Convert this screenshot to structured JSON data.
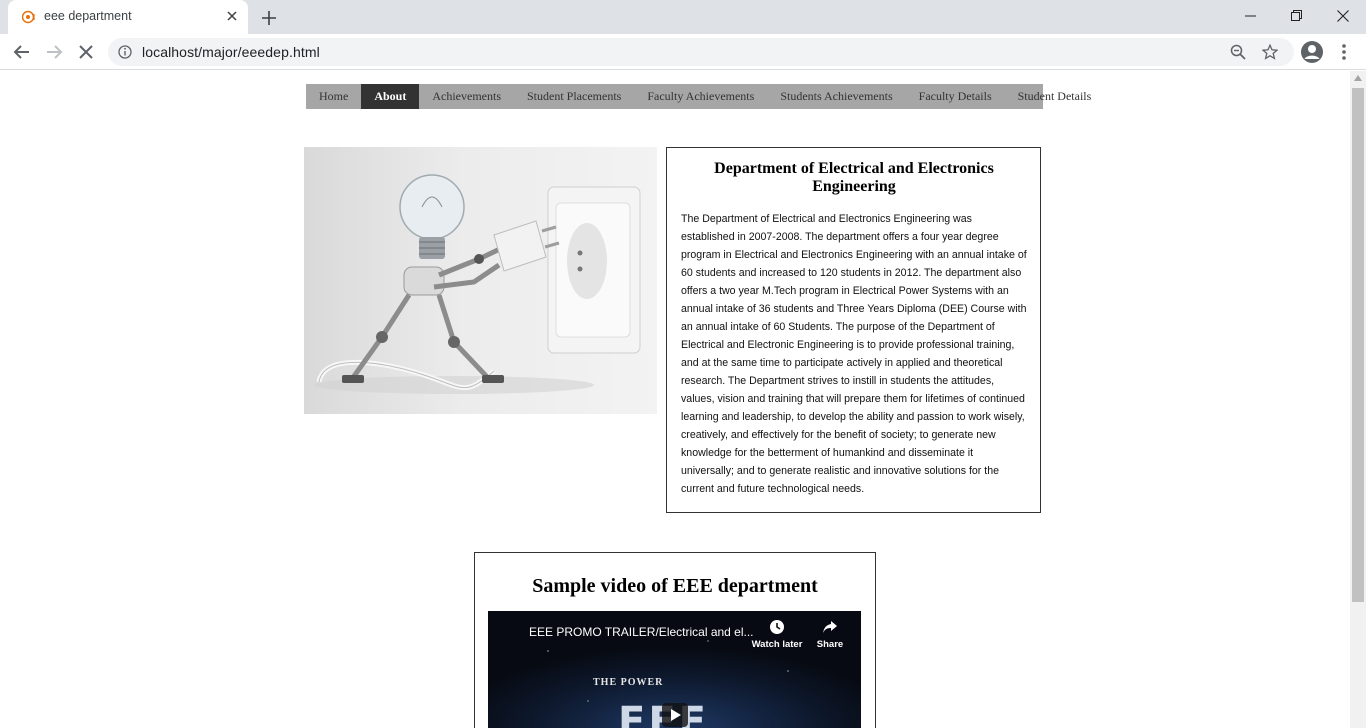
{
  "browser": {
    "tab_title": "eee department",
    "url": "localhost/major/eeedep.html"
  },
  "nav": {
    "items": [
      {
        "label": "Home",
        "active": false
      },
      {
        "label": "About",
        "active": true
      },
      {
        "label": "Achievements",
        "active": false
      },
      {
        "label": "Student Placements",
        "active": false
      },
      {
        "label": "Faculty Achievements",
        "active": false
      },
      {
        "label": "Students Achievements",
        "active": false
      },
      {
        "label": "Faculty Details",
        "active": false
      },
      {
        "label": "Student Details",
        "active": false
      }
    ]
  },
  "about": {
    "title": "Department of Electrical and Electronics Engineering",
    "text": "The Department of Electrical and Electronics Engineering was established in 2007-2008. The department offers a four year degree program in Electrical and Electronics Engineering with an annual intake of 60 students and increased to 120 students in 2012. The department also offers a two year M.Tech program in Electrical Power Systems with an annual intake of 36 students and Three Years Diploma (DEE) Course with an annual intake of 60 Students. The purpose of the Department of Electrical and Electronic Engineering is to provide professional training, and at the same time to participate actively in applied and theoretical research. The Department strives to instill in students the attitudes, values, vision and training that will prepare them for lifetimes of continued learning and leadership, to develop the ability and passion to work wisely, creatively, and effectively for the benefit of society; to generate new knowledge for the betterment of humankind and disseminate it universally; and to generate realistic and innovative solutions for the current and future technological needs."
  },
  "video": {
    "heading": "Sample video of EEE department",
    "title": "EEE PROMO TRAILER/Electrical and el...",
    "watch_later": "Watch later",
    "share": "Share",
    "tagline": "THE POWER",
    "logo_text": "EEE"
  }
}
